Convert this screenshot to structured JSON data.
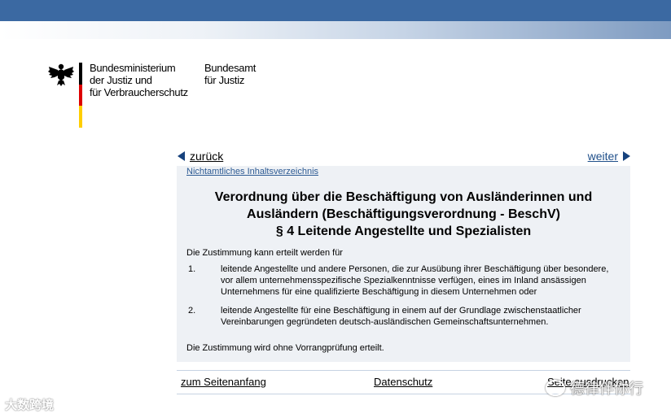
{
  "header": {
    "ministry_lines": [
      "Bundesministerium",
      "der Justiz und",
      "für Verbraucherschutz"
    ],
    "office_lines": [
      "Bundesamt",
      "für Justiz"
    ]
  },
  "nav": {
    "back": "zurück",
    "next": "weiter",
    "toc": "Nichtamtliches Inhaltsverzeichnis"
  },
  "document": {
    "title_lines": [
      "Verordnung über die Beschäftigung von Ausländerinnen und",
      "Ausländern (Beschäftigungsverordnung - BeschV)",
      "§ 4 Leitende Angestellte und Spezialisten"
    ],
    "intro": "Die Zustimmung kann erteilt werden für",
    "items": [
      {
        "num": "1.",
        "text": "leitende Angestellte und andere Personen, die zur Ausübung ihrer Beschäftigung über besondere, vor allem unternehmensspezifische Spezialkenntnisse verfügen, eines im Inland ansässigen Unternehmens für eine qualifizierte Beschäftigung in diesem Unternehmen oder"
      },
      {
        "num": "2.",
        "text": "leitende Angestellte für eine Beschäftigung in einem auf der Grundlage zwischenstaatlicher Vereinbarungen gegründeten deutsch-ausländischen Gemeinschaftsunternehmen."
      }
    ],
    "outro": "Die Zustimmung wird ohne Vorrangprüfung erteilt."
  },
  "footer": {
    "top": "zum Seitenanfang",
    "privacy": "Datenschutz",
    "print": "Seite ausdrucken"
  },
  "watermarks": {
    "left": "大数跨境",
    "right": "德律伴你行"
  },
  "colors": {
    "banner": "#3b69a2",
    "panel": "#eef1f5",
    "link": "#2c5a93",
    "arrow": "#17427d"
  }
}
